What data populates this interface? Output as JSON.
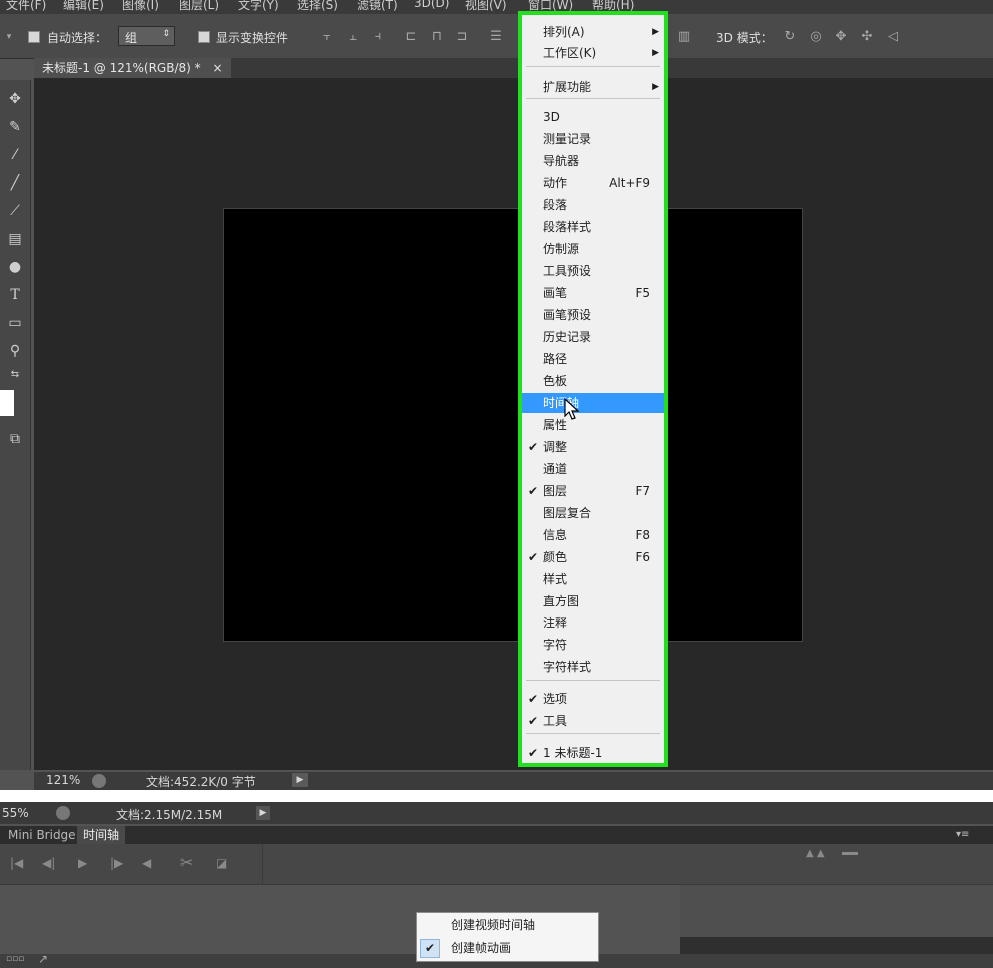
{
  "menubar": {
    "items": [
      "文件(F)",
      "编辑(E)",
      "图像(I)",
      "图层(L)",
      "文字(Y)",
      "选择(S)",
      "滤镜(T)",
      "3D(D)",
      "视图(V)",
      "窗口(W)",
      "帮助(H)"
    ]
  },
  "options_bar": {
    "auto_select_label": "自动选择：",
    "auto_select_value": "组",
    "show_transform_label": "显示变换控件",
    "mode_3d_label": "3D 模式："
  },
  "document": {
    "tab_title": "未标题-1 @ 121%(RGB/8) *",
    "tab_close": "×"
  },
  "status": {
    "zoom": "121%",
    "doc_info": "文档:452.2K/0 字节"
  },
  "window_menu": {
    "items": [
      {
        "label": "排列(A)",
        "submenu": true
      },
      {
        "label": "工作区(K)",
        "submenu": true
      },
      {
        "label": "扩展功能",
        "submenu": true
      },
      {
        "label": "3D"
      },
      {
        "label": "测量记录"
      },
      {
        "label": "导航器"
      },
      {
        "label": "动作",
        "shortcut": "Alt+F9"
      },
      {
        "label": "段落"
      },
      {
        "label": "段落样式"
      },
      {
        "label": "仿制源"
      },
      {
        "label": "工具预设"
      },
      {
        "label": "画笔",
        "shortcut": "F5"
      },
      {
        "label": "画笔预设"
      },
      {
        "label": "历史记录"
      },
      {
        "label": "路径"
      },
      {
        "label": "色板"
      },
      {
        "label": "时间轴",
        "highlighted": true
      },
      {
        "label": "属性"
      },
      {
        "label": "调整",
        "checked": true
      },
      {
        "label": "通道"
      },
      {
        "label": "图层",
        "shortcut": "F7",
        "checked": true
      },
      {
        "label": "图层复合"
      },
      {
        "label": "信息",
        "shortcut": "F8"
      },
      {
        "label": "颜色",
        "shortcut": "F6",
        "checked": true
      },
      {
        "label": "样式"
      },
      {
        "label": "直方图"
      },
      {
        "label": "注释"
      },
      {
        "label": "字符"
      },
      {
        "label": "字符样式"
      },
      {
        "label": "选项",
        "checked": true
      },
      {
        "label": "工具",
        "checked": true
      },
      {
        "label": "1 未标题-1",
        "checked": true
      }
    ],
    "check_glyph": "✔",
    "arrow_glyph": "▶"
  },
  "bottom": {
    "zoom": "55%",
    "doc_info": "文档:2.15M/2.15M",
    "tabs": [
      "Mini Bridge",
      "时间轴"
    ],
    "popup": {
      "items": [
        {
          "label": "创建视频时间轴",
          "checked": false
        },
        {
          "label": "创建帧动画",
          "checked": true
        }
      ]
    }
  },
  "colors": {
    "highlight": "#3399ff",
    "annotation_border": "#22e01e",
    "menu_bg": "#f0f0f0",
    "ui_dark": "#535353"
  }
}
